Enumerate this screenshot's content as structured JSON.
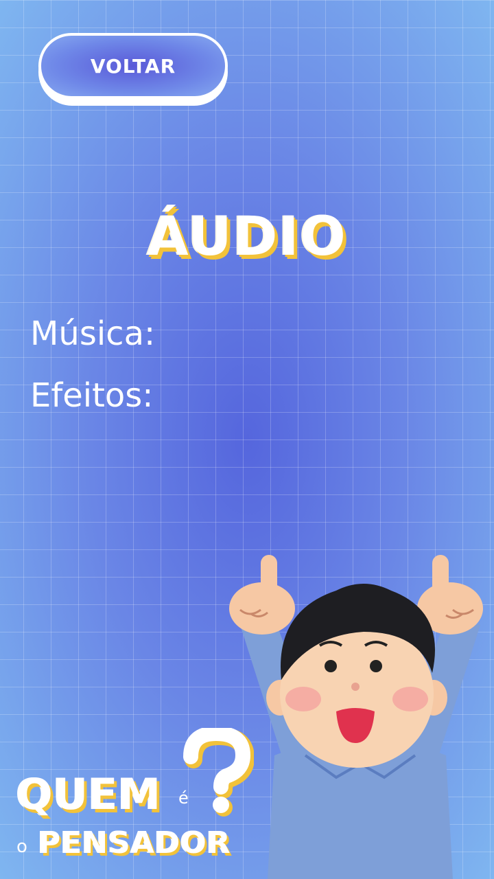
{
  "nav": {
    "back_label": "VOLTAR"
  },
  "settings": {
    "title": "ÁUDIO",
    "music_label": "Música:",
    "effects_label": "Efeitos:"
  },
  "branding": {
    "line1": "QUEM",
    "small_e": "é",
    "small_o": "o",
    "line2": "PENSADOR",
    "question_mark": "?"
  },
  "colors": {
    "accent_yellow": "#f2c23a",
    "text": "#ffffff",
    "background_center": "#5566dd",
    "background_edge": "#7fb6f0"
  }
}
